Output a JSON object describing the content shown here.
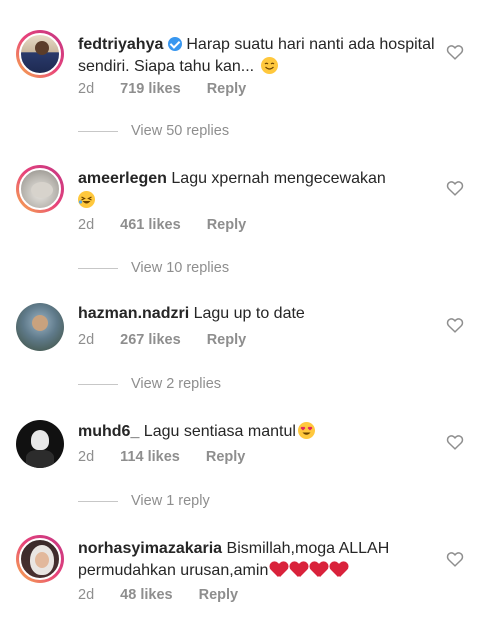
{
  "comments": [
    {
      "username": "fedtriyahya",
      "verified": true,
      "text": "Harap suatu hari nanti ada hospital sendiri. Siapa tahu kan...",
      "emoji": "smiling-face-emoji",
      "time": "2d",
      "likes": "719 likes",
      "reply_label": "Reply",
      "view_replies": "View 50 replies"
    },
    {
      "username": "ameerlegen",
      "verified": false,
      "text": "Lagu xpernah mengecewakan",
      "emoji": "laughing-face-emoji",
      "time": "2d",
      "likes": "461 likes",
      "reply_label": "Reply",
      "view_replies": "View 10 replies"
    },
    {
      "username": "hazman.nadzri",
      "verified": false,
      "text": "Lagu up to date",
      "time": "2d",
      "likes": "267 likes",
      "reply_label": "Reply",
      "view_replies": "View 2 replies"
    },
    {
      "username": "muhd6_",
      "verified": false,
      "text": "Lagu sentiasa mantul",
      "emoji": "heart-eyes-emoji",
      "time": "2d",
      "likes": "114 likes",
      "reply_label": "Reply",
      "view_replies": "View 1 reply"
    },
    {
      "username": "norhasyimazakaria",
      "verified": false,
      "text": "Bismillah,moga ALLAH permudahkan urusan,amin",
      "emoji": "red-heart-emoji",
      "time": "2d",
      "likes": "48 likes",
      "reply_label": "Reply"
    }
  ],
  "colors": {
    "text": "#262626",
    "meta": "#8e8e8e",
    "verified": "#3897f0",
    "heart": "#d9223b"
  }
}
